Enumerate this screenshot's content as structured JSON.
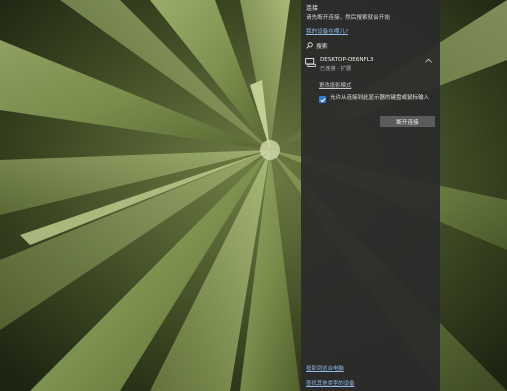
{
  "panel": {
    "title": "连接",
    "description": "请先断开连接，然后搜索就会开始",
    "help_link": "我的设备在哪儿?",
    "search_label": "搜索",
    "device": {
      "name": "DESKTOP-OE6NFL3",
      "status": "已连接 - 扩展",
      "icon": "display-icon"
    },
    "projection_mode_link": "更改投影模式",
    "allow_input_checkbox": {
      "checked": true,
      "label": "允许从连接到此显示器的键盘或鼠标输入"
    },
    "disconnect_button": "断开连接",
    "bottom_links": [
      "投影到这台电脑",
      "查找其他类型的设备"
    ]
  },
  "colors": {
    "panel_bg": "#2b2b2b",
    "link": "#8fb8e6",
    "checkbox_accent": "#2f7fd4",
    "button_bg": "#5b5b5b"
  }
}
